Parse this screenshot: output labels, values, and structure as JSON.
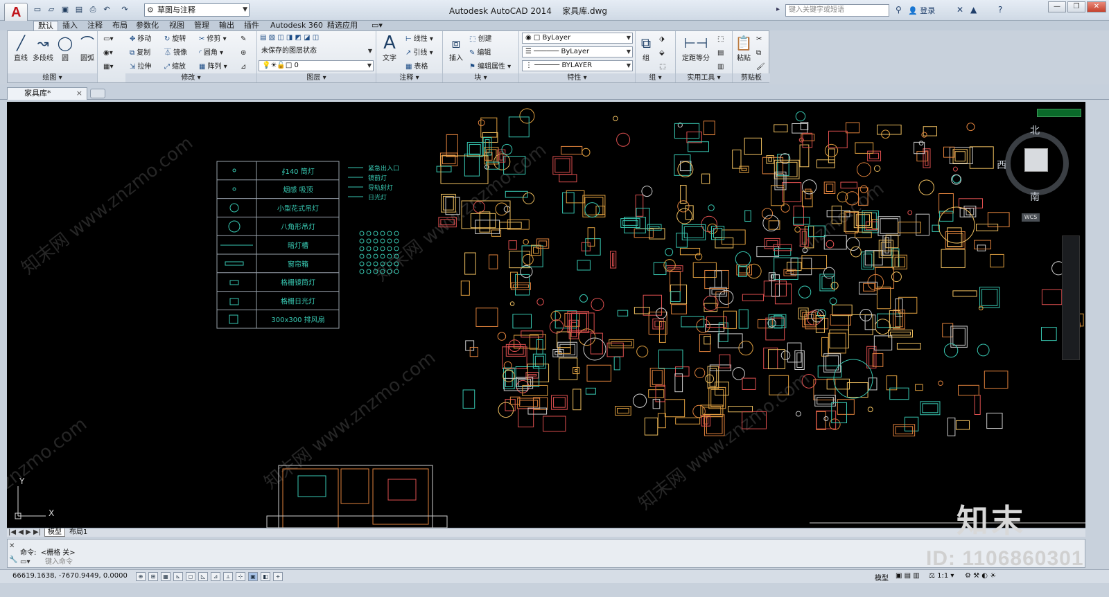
{
  "app": {
    "logo_letter": "A",
    "title": "Autodesk AutoCAD 2014",
    "filename": "家具库.dwg"
  },
  "workspace": {
    "value": "草图与注释"
  },
  "search": {
    "placeholder": "键入关键字或短语"
  },
  "account": {
    "login": "登录"
  },
  "ribbon_tabs": [
    "默认",
    "插入",
    "注释",
    "布局",
    "参数化",
    "视图",
    "管理",
    "输出",
    "插件",
    "Autodesk 360",
    "精选应用"
  ],
  "panels": {
    "draw": {
      "title": "绘图",
      "line": "直线",
      "polyline": "多段线",
      "circle": "圆",
      "arc": "圆弧"
    },
    "modify": {
      "title": "修改",
      "move": "移动",
      "rotate": "旋转",
      "trim": "修剪",
      "copy": "复制",
      "mirror": "镜像",
      "fillet": "圆角",
      "stretch": "拉伸",
      "scale": "缩放",
      "array": "阵列"
    },
    "layers": {
      "title": "图层",
      "state": "未保存的图层状态",
      "current": "0"
    },
    "annotation": {
      "title": "注释",
      "text": "文字",
      "linear": "线性",
      "leader": "引线",
      "table": "表格"
    },
    "block": {
      "title": "块",
      "insert": "插入",
      "create": "创建",
      "edit": "编辑",
      "edit_attr": "编辑属性"
    },
    "properties": {
      "title": "特性",
      "color": "ByLayer",
      "linetype": "ByLayer",
      "lineweight": "BYLAYER"
    },
    "groups": {
      "title": "组",
      "group": "组"
    },
    "utilities": {
      "title": "实用工具",
      "measure": "定距等分"
    },
    "clipboard": {
      "title": "剪贴板",
      "paste": "粘贴"
    }
  },
  "doc_tab": {
    "label": "家具库*"
  },
  "legend": {
    "rows": [
      {
        "label": "∮140 筒灯"
      },
      {
        "label": "烟感 吸顶"
      },
      {
        "label": "小型花式吊灯"
      },
      {
        "label": "八角形吊灯"
      },
      {
        "label": "暗灯槽"
      },
      {
        "label": "窗帘箱"
      },
      {
        "label": "格栅镜筒灯"
      },
      {
        "label": "格栅日光灯"
      },
      {
        "label": "300x300 排风扇"
      }
    ],
    "side": [
      "紧急出入口",
      "镜前灯",
      "导轨射灯",
      "日光灯"
    ]
  },
  "viewcube": {
    "north": "北",
    "west": "西",
    "south": "南",
    "wcs": "WCS"
  },
  "ucs": {
    "y": "Y",
    "x": "X"
  },
  "layout_tabs": {
    "model": "模型",
    "layout1": "布局1"
  },
  "command": {
    "history_prefix": "命令:",
    "history_text": "<栅格 关>",
    "placeholder": "键入命令"
  },
  "status": {
    "coords": "66619.1638,  -7670.9449,  0.0000",
    "model": "模型",
    "scale": "1:1"
  },
  "watermark": {
    "brand": "知末",
    "id": "ID: 1106860301"
  }
}
